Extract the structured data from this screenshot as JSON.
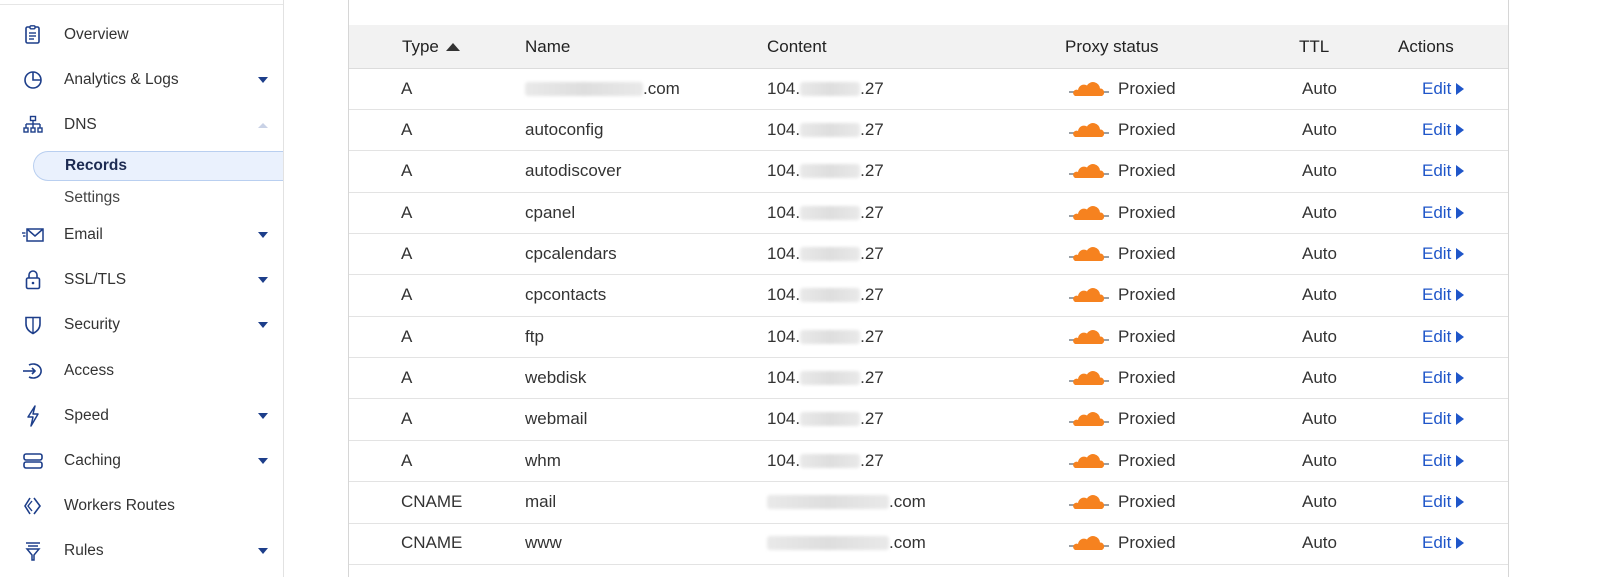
{
  "sidebar": {
    "items": [
      {
        "label": "Overview",
        "icon": "document-icon",
        "caret": "none"
      },
      {
        "label": "Analytics & Logs",
        "icon": "pie-chart-icon",
        "caret": "down"
      },
      {
        "label": "DNS",
        "icon": "network-icon",
        "caret": "up"
      },
      {
        "label": "Email",
        "icon": "mail-icon",
        "caret": "down"
      },
      {
        "label": "SSL/TLS",
        "icon": "lock-icon",
        "caret": "down"
      },
      {
        "label": "Security",
        "icon": "shield-icon",
        "caret": "down"
      },
      {
        "label": "Access",
        "icon": "access-icon",
        "caret": "none"
      },
      {
        "label": "Speed",
        "icon": "lightning-icon",
        "caret": "down"
      },
      {
        "label": "Caching",
        "icon": "server-icon",
        "caret": "down"
      },
      {
        "label": "Workers Routes",
        "icon": "workers-icon",
        "caret": "none"
      },
      {
        "label": "Rules",
        "icon": "filter-icon",
        "caret": "down"
      }
    ],
    "dns_sub": [
      {
        "label": "Records",
        "active": true
      },
      {
        "label": "Settings",
        "active": false
      }
    ]
  },
  "table": {
    "headers": {
      "type": "Type",
      "name": "Name",
      "content": "Content",
      "proxy": "Proxy status",
      "ttl": "TTL",
      "actions": "Actions"
    },
    "sorted_by": "type",
    "rows": [
      {
        "type": "A",
        "name_suffix": ".com",
        "content_prefix": "104.",
        "content_suffix": ".27",
        "proxy": "Proxied",
        "ttl": "Auto",
        "action": "Edit"
      },
      {
        "type": "A",
        "name": "autoconfig",
        "content_prefix": "104.",
        "content_suffix": ".27",
        "proxy": "Proxied",
        "ttl": "Auto",
        "action": "Edit"
      },
      {
        "type": "A",
        "name": "autodiscover",
        "content_prefix": "104.",
        "content_suffix": ".27",
        "proxy": "Proxied",
        "ttl": "Auto",
        "action": "Edit"
      },
      {
        "type": "A",
        "name": "cpanel",
        "content_prefix": "104.",
        "content_suffix": ".27",
        "proxy": "Proxied",
        "ttl": "Auto",
        "action": "Edit"
      },
      {
        "type": "A",
        "name": "cpcalendars",
        "content_prefix": "104.",
        "content_suffix": ".27",
        "proxy": "Proxied",
        "ttl": "Auto",
        "action": "Edit"
      },
      {
        "type": "A",
        "name": "cpcontacts",
        "content_prefix": "104.",
        "content_suffix": ".27",
        "proxy": "Proxied",
        "ttl": "Auto",
        "action": "Edit"
      },
      {
        "type": "A",
        "name": "ftp",
        "content_prefix": "104.",
        "content_suffix": ".27",
        "proxy": "Proxied",
        "ttl": "Auto",
        "action": "Edit"
      },
      {
        "type": "A",
        "name": "webdisk",
        "content_prefix": "104.",
        "content_suffix": ".27",
        "proxy": "Proxied",
        "ttl": "Auto",
        "action": "Edit"
      },
      {
        "type": "A",
        "name": "webmail",
        "content_prefix": "104.",
        "content_suffix": ".27",
        "proxy": "Proxied",
        "ttl": "Auto",
        "action": "Edit"
      },
      {
        "type": "A",
        "name": "whm",
        "content_prefix": "104.",
        "content_suffix": ".27",
        "proxy": "Proxied",
        "ttl": "Auto",
        "action": "Edit"
      },
      {
        "type": "CNAME",
        "name": "mail",
        "content_suffix": ".com",
        "proxy": "Proxied",
        "ttl": "Auto",
        "action": "Edit"
      },
      {
        "type": "CNAME",
        "name": "www",
        "content_suffix": ".com",
        "proxy": "Proxied",
        "ttl": "Auto",
        "action": "Edit"
      }
    ]
  },
  "colors": {
    "accent": "#1d3e8a",
    "link": "#1f56c9",
    "cloud": "#f6821f",
    "header_bg": "#f2f2f2",
    "active_bg": "#eaf1fd"
  }
}
